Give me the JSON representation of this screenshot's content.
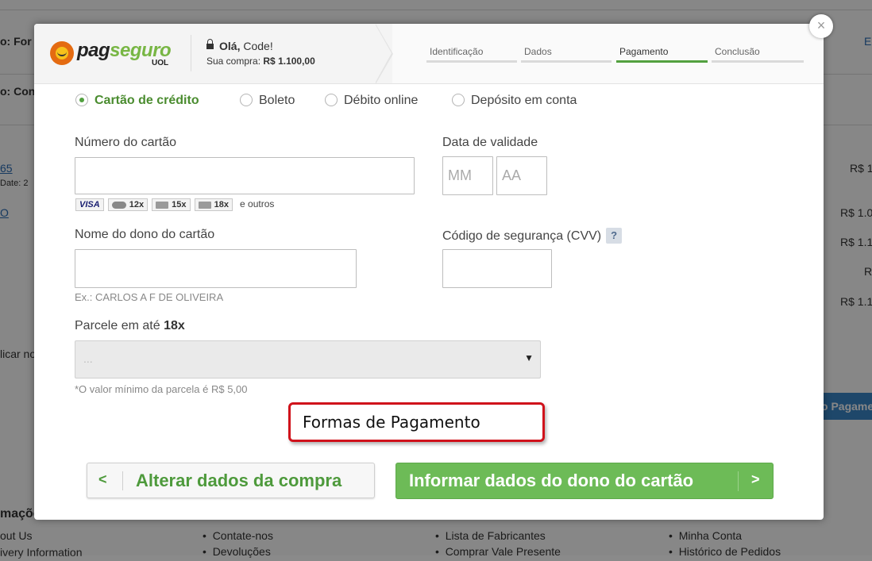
{
  "background": {
    "left_fragments": [
      "o: For",
      "o: Con",
      "65",
      "Date: 2",
      "O",
      "licar no",
      "mações",
      "out Us",
      "ivery Information"
    ],
    "right_fragments": [
      "E",
      "R$ 1",
      "R$ 1.0",
      "R$ 1.1",
      "R",
      "R$ 1.1"
    ],
    "blue_button": "o Pagame",
    "footer_col2": [
      "Contate-nos",
      "Devoluções"
    ],
    "footer_col3": [
      "Lista de Fabricantes",
      "Comprar Vale Presente"
    ],
    "footer_col4": [
      "Minha Conta",
      "Histórico de Pedidos"
    ]
  },
  "modal": {
    "close_label": "×",
    "logo": {
      "part1": "pag",
      "part2": "seguro",
      "sub": "UOL"
    },
    "greeting_prefix": "Olá,",
    "greeting_name": "Code!",
    "purchase_label": "Sua compra:",
    "purchase_value": "R$ 1.100,00",
    "steps": [
      "Identificação",
      "Dados",
      "Pagamento",
      "Conclusão"
    ],
    "active_step": "Pagamento",
    "payment_options": [
      "Cartão de crédito",
      "Boleto",
      "Débito online",
      "Depósito em conta"
    ],
    "selected_option": "Cartão de crédito",
    "card_number_label": "Número do cartão",
    "card_number_value": "",
    "expiry_label": "Data de validade",
    "expiry_month_placeholder": "MM",
    "expiry_year_placeholder": "AA",
    "card_brands": {
      "visa": "VISA",
      "b1": "12x",
      "b2": "15x",
      "b3": "18x",
      "others": "e outros"
    },
    "owner_label": "Nome do dono do cartão",
    "owner_value": "",
    "owner_hint": "Ex.: CARLOS A F DE OLIVEIRA",
    "cvv_label": "Código de segurança (CVV)",
    "cvv_help": "?",
    "installments_label_prefix": "Parcele em até",
    "installments_max": "18x",
    "installments_selected": "...",
    "installments_hint": "*O valor mínimo da parcela é R$ 5,00",
    "annotation": "Formas de Pagamento",
    "back_button": "Alterar dados da compra",
    "next_button": "Informar dados do dono do cartão"
  },
  "colors": {
    "accent_green": "#52a03f",
    "button_green": "#6dbb57",
    "annotation_red": "#d0121b"
  }
}
